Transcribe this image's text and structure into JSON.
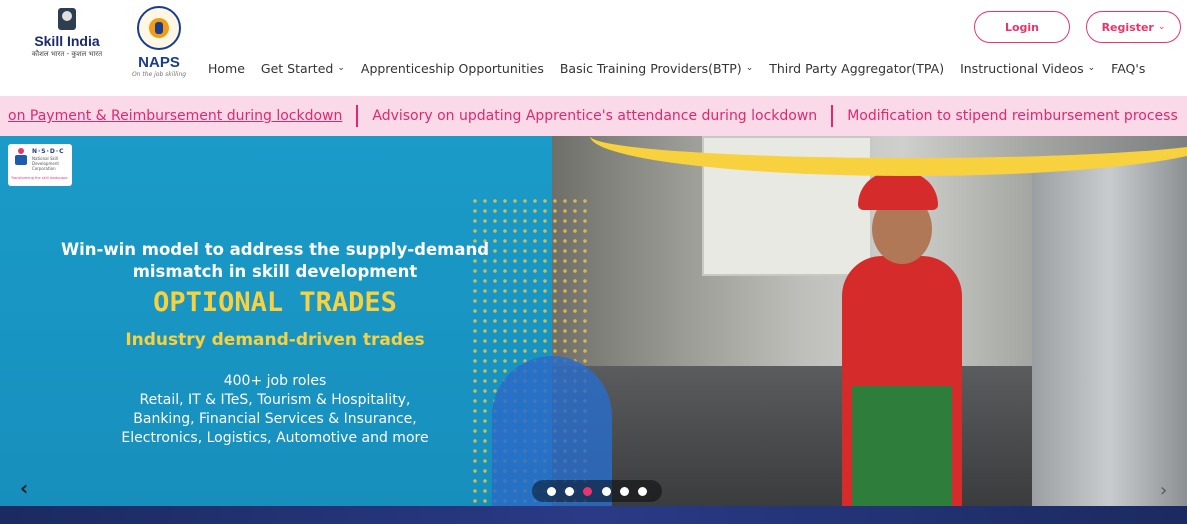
{
  "header": {
    "skill_logo": {
      "name": "Skill India",
      "tagline": "कौशल भारत - कुशल भारत"
    },
    "naps_logo": {
      "name": "NAPS",
      "tagline": "On the job skilling"
    },
    "nav": [
      {
        "label": "Home",
        "dropdown": false
      },
      {
        "label": "Get Started",
        "dropdown": true
      },
      {
        "label": "Apprenticeship Opportunities",
        "dropdown": false
      },
      {
        "label": "Basic Training Providers(BTP)",
        "dropdown": true
      },
      {
        "label": "Third Party Aggregator(TPA)",
        "dropdown": false
      },
      {
        "label": "Instructional Videos",
        "dropdown": true
      },
      {
        "label": "FAQ's",
        "dropdown": false
      }
    ],
    "login_label": "Login",
    "register_label": "Register"
  },
  "ticker": {
    "items": [
      "on Payment & Reimbursement during lockdown",
      "Advisory on updating Apprentice's attendance during lockdown",
      "Modification to stipend reimbursement process"
    ]
  },
  "banner": {
    "nsdc_logo": {
      "abbr": "N·S·D·C",
      "full": "National Skill Development Corporation",
      "tagline": "Transforming the skill landscape"
    },
    "headline_line1": "Win-win model to address the supply-demand",
    "headline_line2": "mismatch in skill development",
    "title": "OPTIONAL TRADES",
    "subtitle": "Industry demand-driven trades",
    "jobs_line1": "400+ job roles",
    "jobs_line2": "Retail, IT & ITeS, Tourism & Hospitality,",
    "jobs_line3": "Banking, Financial Services & Insurance,",
    "jobs_line4": "Electronics, Logistics, Automotive and more",
    "prev_arrow": "‹",
    "next_arrow": "›",
    "slides": 6,
    "active_slide": 3
  },
  "colors": {
    "accent": "#e8356f",
    "ticker_bg": "#fad9e8",
    "banner_blue": "#1a9bc8",
    "yellow": "#f7d23e",
    "footer": "#1b2a60"
  }
}
